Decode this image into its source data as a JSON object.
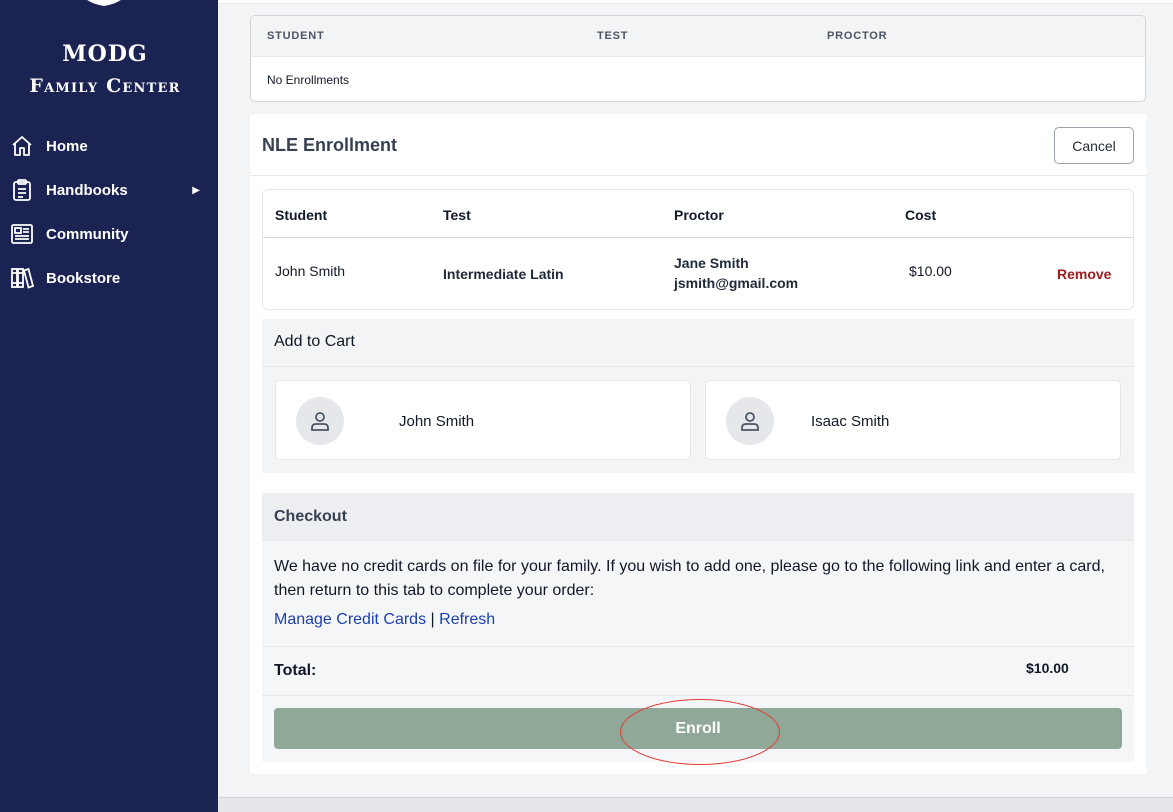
{
  "sidebar": {
    "brand_line1": "MODG",
    "brand_line2": "Family Center",
    "items": [
      {
        "label": "Home",
        "icon": "home-icon"
      },
      {
        "label": "Handbooks",
        "icon": "clipboard-icon",
        "caret": "▶"
      },
      {
        "label": "Community",
        "icon": "newspaper-icon"
      },
      {
        "label": "Bookstore",
        "icon": "books-icon"
      }
    ]
  },
  "enrollments": {
    "columns": [
      "STUDENT",
      "TEST",
      "PROCTOR"
    ],
    "empty_text": "No Enrollments"
  },
  "nle": {
    "title": "NLE Enrollment",
    "cancel_label": "Cancel",
    "columns": [
      "Student",
      "Test",
      "Proctor",
      "Cost"
    ],
    "rows": [
      {
        "student": "John Smith",
        "test": "Intermediate Latin",
        "proctor_name": "Jane Smith",
        "proctor_email": "jsmith@gmail.com",
        "cost": "$10.00",
        "action": "Remove"
      }
    ]
  },
  "add_to_cart": {
    "title": "Add to Cart",
    "students": [
      "John Smith",
      "Isaac Smith"
    ]
  },
  "checkout": {
    "title": "Checkout",
    "message": "We have no credit cards on file for your family. If you wish to add one, please go to the following link and enter a card, then return to this tab to complete your order:",
    "manage_link": "Manage Credit Cards",
    "separator": "|",
    "refresh_link": "Refresh",
    "total_label": "Total:",
    "total_value": "$10.00",
    "enroll_label": "Enroll"
  },
  "colors": {
    "sidebar_bg": "#1b2352",
    "enroll_button": "#8fa898",
    "remove_link": "#9b1c1c",
    "link": "#1e40af",
    "highlight": "#e53935"
  }
}
